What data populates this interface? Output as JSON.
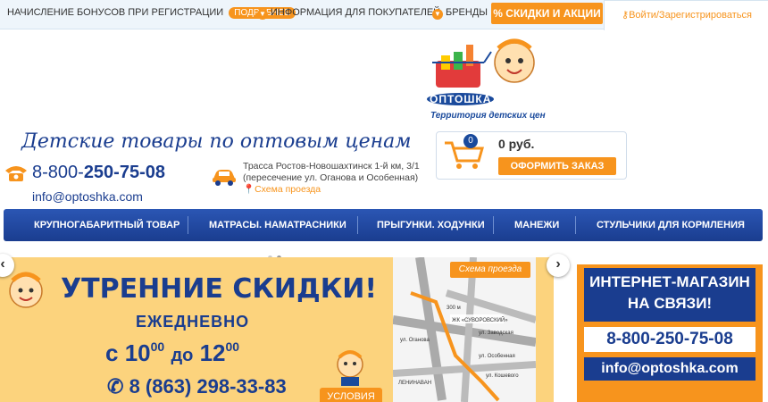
{
  "topbar": {
    "bonus_text": "НАЧИСЛЕНИЕ БОНУСОВ ПРИ РЕГИСТРАЦИИ",
    "bonus_badge": "ПОДРОБНЕЕ",
    "buyers_info": "ИНФОРМАЦИЯ ДЛЯ ПОКУПАТЕЛЕЙ",
    "brands": "БРЕНДЫ",
    "sale_button": "% СКИДКИ И АКЦИИ",
    "login": "Войти/Зарегистрироваться"
  },
  "logo": {
    "brand": "ОПТОШКА",
    "tagline": "Территория детских цен"
  },
  "header": {
    "slogan": "Детские товары по оптовым ценам",
    "phone_prefix": "8-800-",
    "phone_main": "250-75-08",
    "email": "info@optoshka.com",
    "address": "Трасса Ростов-Новошахтинск 1-й км, 3/1 (пересечение ул. Оганова и Особенная)",
    "route_link": "Схема проезда"
  },
  "cart": {
    "count": "0",
    "price": "0 руб.",
    "order_button": "ОФОРМИТЬ ЗАКАЗ"
  },
  "nav": {
    "items": [
      "КРУПНОГАБАРИТНЫЙ ТОВАР",
      "МАТРАСЫ. НАМАТРАСНИКИ",
      "ПРЫГУНКИ. ХОДУНКИ",
      "МАНЕЖИ",
      "СТУЛЬЧИКИ ДЛЯ КОРМЛЕНИЯ"
    ]
  },
  "banner": {
    "title": "УТРЕННИЕ СКИДКИ!",
    "subtitle": "ЕЖЕДНЕВНО",
    "time_from_label": "с",
    "time_from": "10",
    "time_mid": "до",
    "time_to": "12",
    "time_sup": "00",
    "phone": "8 (863) 298-33-83",
    "conditions": "УСЛОВИЯ",
    "map_label": "Схема проезда",
    "map_streets": [
      "ЖК «СУВОРОВСКИЙ»",
      "ЛЕНИНАВАН",
      "ул. Оганова",
      "ул. Особенная",
      "ул. Заводская",
      "300 м",
      "ул. Кошевого"
    ]
  },
  "side_banner": {
    "title_line1": "ИНТЕРНЕТ-МАГАЗИН",
    "title_line2": "НА СВЯЗИ!",
    "phone": "8-800-250-75-08",
    "email": "info@optoshka.com"
  },
  "colors": {
    "accent": "#f7941d",
    "brand_blue": "#1a3d8f",
    "banner_bg": "#fcd37d"
  }
}
